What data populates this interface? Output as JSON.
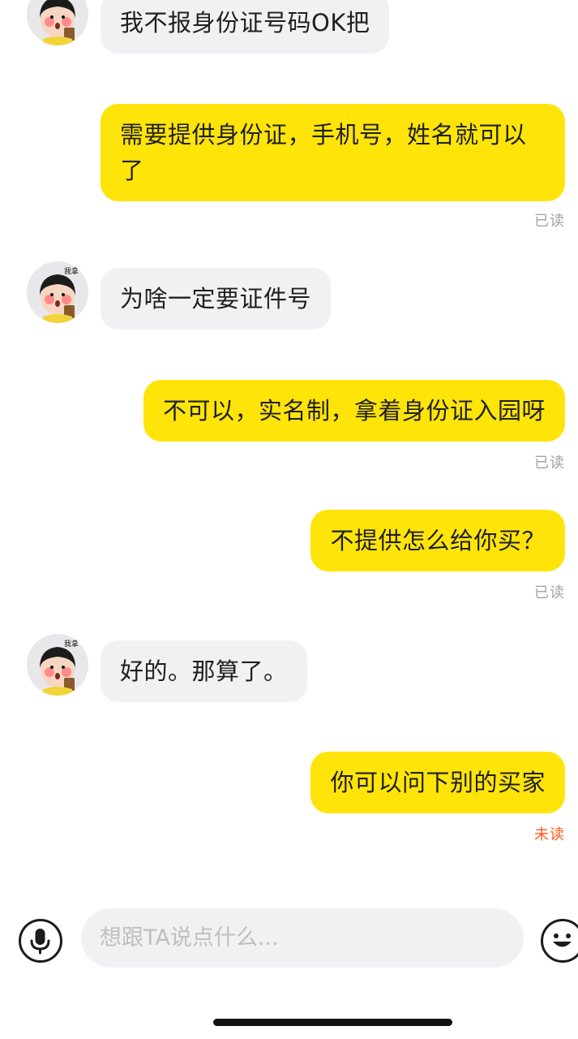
{
  "messages": [
    {
      "side": "in",
      "text": "我不报身份证号码OK把"
    },
    {
      "side": "out",
      "text": "需要提供身份证，手机号，姓名就可以了",
      "receipt": "已读"
    },
    {
      "side": "in",
      "text": "为啥一定要证件号"
    },
    {
      "side": "out",
      "text": "不可以，实名制，拿着身份证入园呀",
      "receipt": "已读"
    },
    {
      "side": "out",
      "text": "不提供怎么给你买？",
      "receipt": "已读"
    },
    {
      "side": "in",
      "text": "好的。那算了。"
    },
    {
      "side": "out",
      "text": "你可以问下别的买家",
      "receipt": "未读"
    }
  ],
  "avatar": {
    "badge_text": "我拿"
  },
  "input": {
    "placeholder": "想跟TA说点什么..."
  },
  "icons": {
    "voice": "microphone-icon",
    "emoji": "emoji-face-icon"
  },
  "colors": {
    "outgoing_bubble": "#ffe40a",
    "incoming_bubble": "#f1f1f3",
    "unread": "#ff5a1f",
    "read": "#a3a3a3"
  }
}
